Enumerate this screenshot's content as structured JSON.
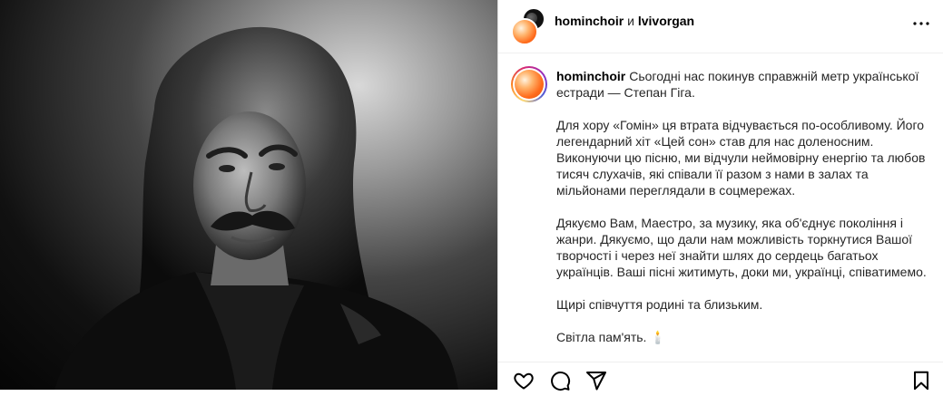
{
  "header": {
    "user1": "hominchoir",
    "conjunction": "и",
    "user2": "lvivorgan"
  },
  "post": {
    "image_alt": "Black-and-white portrait of a man with long hair and a mustache in a leather jacket",
    "caption": {
      "username": "hominchoir",
      "first_line": "Сьогодні нас покинув справжній метр української естради — Степан Гіга.",
      "p2": "Для хору «Гомін» ця втрата відчувається по-особливому. Його легендарний хіт «Цей сон» став для нас доленосним. Виконуючи цю пісню, ми відчули неймовірну енергію та любов тисяч слухачів, які співали її разом з нами в залах та мільйонами переглядали в соцмережах.",
      "p3": "Дякуємо Вам, Маестро, за музику, яка об'єднує покоління і жанри. Дякуємо, що дали нам можливість торкнутися Вашої творчості і через неї знайти шлях до сердець багатьох українців. Ваші пісні житимуть, доки ми, українці, співатимемо.",
      "p4": "Щирі співчуття родині та близьким.",
      "p5": "Світла пам'ять. 🕯️"
    }
  },
  "icons": {
    "more": "more-icon",
    "like": "heart-icon",
    "comment": "comment-icon",
    "share": "share-icon",
    "save": "bookmark-icon"
  }
}
